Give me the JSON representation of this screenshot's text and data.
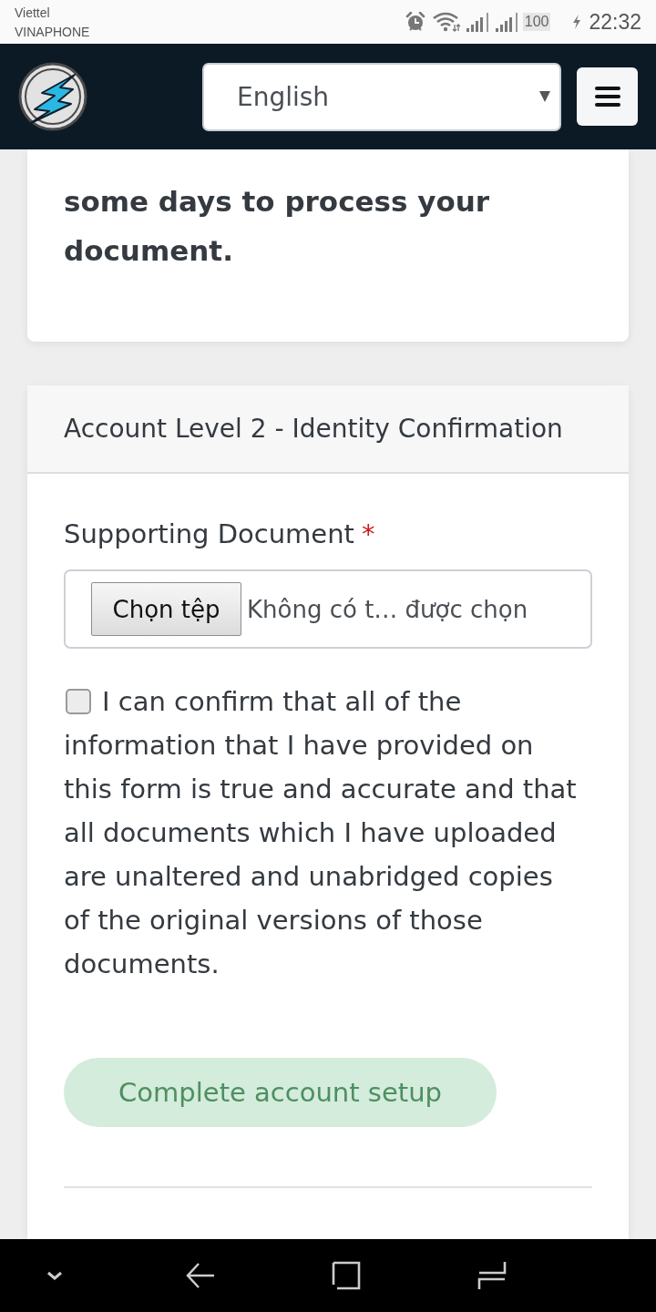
{
  "status_bar": {
    "carriers": [
      "Viettel",
      "VINAPHONE"
    ],
    "battery": "100",
    "charging": true,
    "time": "22:32"
  },
  "header": {
    "language_select": {
      "value": "English"
    }
  },
  "notice_card": {
    "text": "some days to process your document."
  },
  "identity_card": {
    "title": "Account Level 2 - Identity Confirmation",
    "document_field": {
      "label": "Supporting Document",
      "required_mark": "*",
      "button": "Chọn tệp",
      "status": "Không có t… được chọn"
    },
    "confirm": {
      "checked": false,
      "label": "I can confirm that all of the information that I have provided on this form is true and accurate and that all documents which I have uploaded are unaltered and unabridged copies of the original versions of those documents."
    },
    "submit": {
      "label": "Complete account setup",
      "disabled": true
    }
  }
}
